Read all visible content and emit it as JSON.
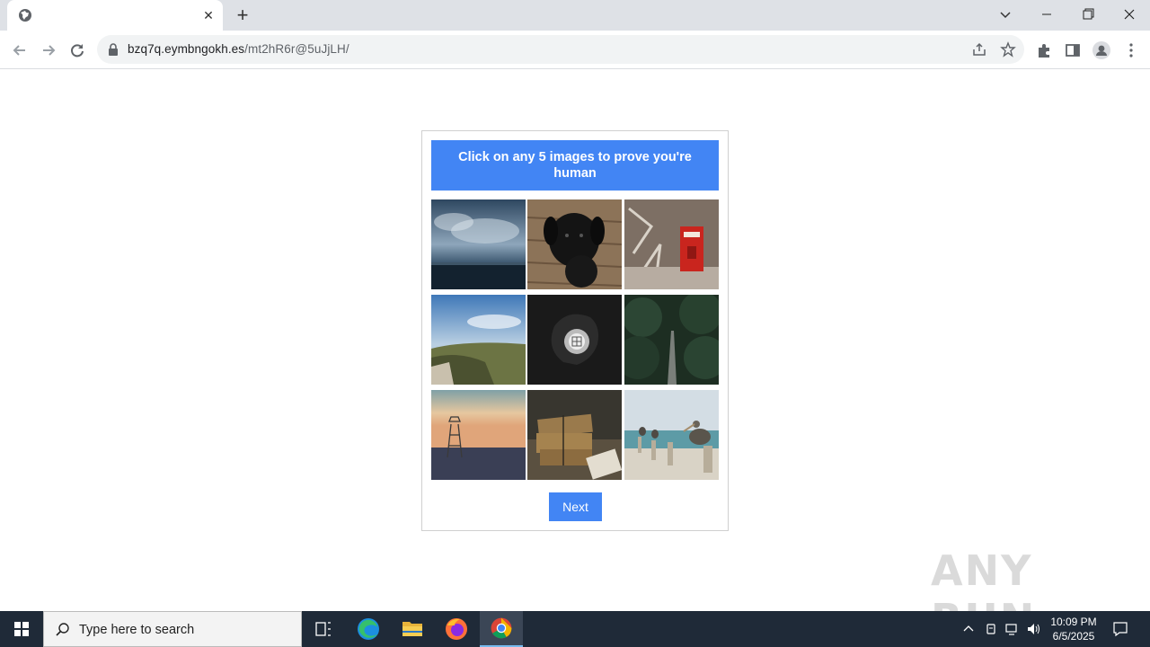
{
  "browser": {
    "tab": {
      "close_glyph": "✕"
    },
    "new_tab_glyph": "+",
    "address": {
      "host": "bzq7q.eymbngokh.es",
      "path": "/mt2hR6r@5uJjLH/"
    }
  },
  "captcha": {
    "title": "Click on any 5 images to prove you're human",
    "images": [
      {
        "name": "stormy-sea-image"
      },
      {
        "name": "black-dog-image"
      },
      {
        "name": "red-mailbox-image"
      },
      {
        "name": "hillside-sky-image"
      },
      {
        "name": "speaker-image"
      },
      {
        "name": "forest-road-image"
      },
      {
        "name": "lifeguard-tower-image"
      },
      {
        "name": "parcels-image"
      },
      {
        "name": "pelicans-pier-image"
      }
    ],
    "next_label": "Next"
  },
  "watermark": "ANY RUN",
  "taskbar": {
    "search_placeholder": "Type here to search",
    "time": "10:09 PM",
    "date": "6/5/2025"
  },
  "colors": {
    "accent": "#4285f4",
    "taskbar": "#1f2a38",
    "tabstrip": "#dee1e6"
  }
}
